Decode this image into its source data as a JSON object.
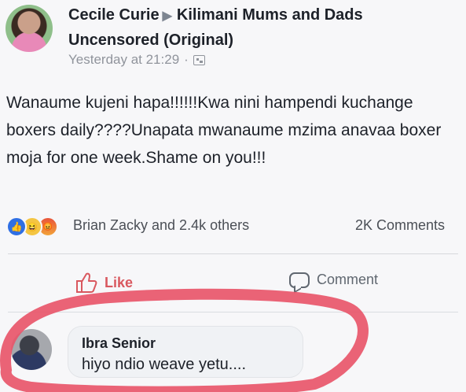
{
  "post": {
    "author": "Cecile Curie",
    "group": "Kilimani Mums and Dads Uncensored (Original)",
    "timestamp": "Yesterday at 21:29",
    "separator": "·",
    "text": "Wanaume kujeni hapa!!!!!!Kwa nini hampendi kuchange boxers daily????Unapata mwanaume mzima anavaa boxer moja for one week.Shame on you!!!",
    "reactors": "Brian Zacky and 2.4k others",
    "comments_count": "2K Comments"
  },
  "actions": {
    "like_label": "Like",
    "comment_label": "Comment"
  },
  "comment": {
    "author": "Ibra Senior",
    "text": "hiyo ndio weave yetu...."
  },
  "icons": {
    "arrow": "right-triangle-icon",
    "privacy": "group-icon",
    "like": "thumbs-up-icon",
    "comment": "speech-bubble-icon"
  },
  "colors": {
    "like_active": "#d9585f",
    "scribble": "#e8566a",
    "reaction_like": "#2f6fe4",
    "reaction_haha": "#f4c542"
  }
}
